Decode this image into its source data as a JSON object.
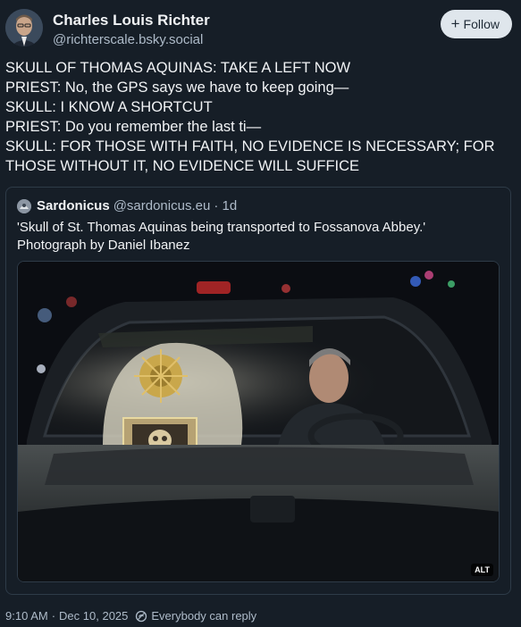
{
  "author": {
    "name": "Charles Louis Richter",
    "handle": "@richterscale.bsky.social"
  },
  "follow_button": {
    "label": "Follow",
    "icon": "plus-icon"
  },
  "post": {
    "lines": [
      "SKULL OF THOMAS AQUINAS: TAKE A LEFT NOW",
      "PRIEST: No, the GPS says we have to keep going—",
      "SKULL: I KNOW A SHORTCUT",
      "PRIEST: Do you remember the last ti—",
      "SKULL: FOR THOSE WITH FAITH, NO EVIDENCE IS NECESSARY; FOR",
      "THOSE WITHOUT IT, NO EVIDENCE WILL SUFFICE"
    ]
  },
  "quote": {
    "name": "Sardonicus",
    "handle": "@sardonicus.eu",
    "time": "· 1d",
    "lines": [
      "'Skull of St. Thomas Aquinas being transported to Fossanova Abbey.'",
      "Photograph by Daniel Ibanez"
    ],
    "alt_label": "ALT"
  },
  "footer": {
    "timestamp": "9:10 AM",
    "separator": "·",
    "date": "Dec 10, 2025",
    "reply_setting": "Everybody can reply"
  }
}
